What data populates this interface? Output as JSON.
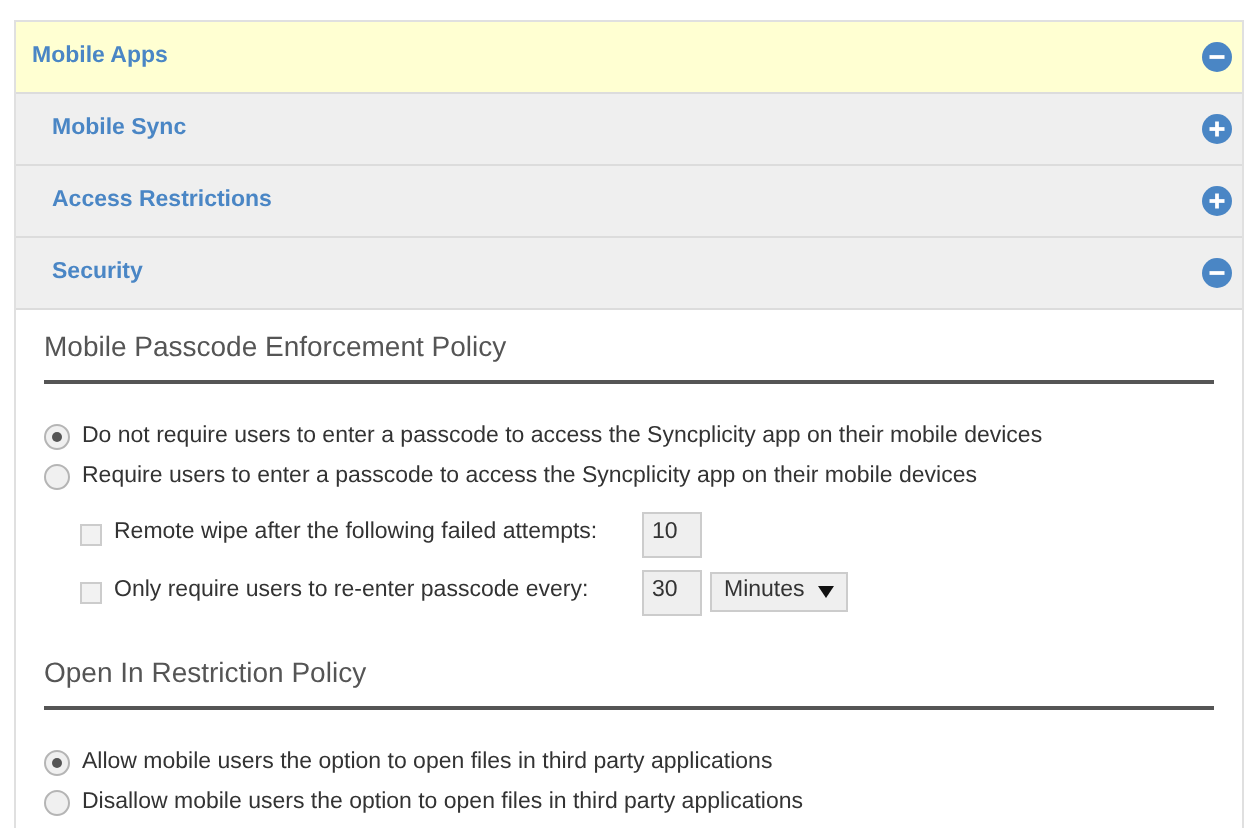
{
  "accordion": {
    "title": "Mobile Apps",
    "expanded": true,
    "sections": [
      {
        "title": "Mobile Sync",
        "expanded": false
      },
      {
        "title": "Access Restrictions",
        "expanded": false
      },
      {
        "title": "Security",
        "expanded": true
      }
    ]
  },
  "security": {
    "policies": [
      {
        "title": "Mobile Passcode Enforcement Policy",
        "options": [
          {
            "label": "Do not require users to enter a passcode to access the Syncplicity app on their mobile devices",
            "selected": true
          },
          {
            "label": "Require users to enter a passcode to access the Syncplicity app on their mobile devices",
            "selected": false
          }
        ],
        "settings": [
          {
            "label": "Remote wipe after the following failed attempts:",
            "checked": false,
            "value": "10"
          },
          {
            "label": "Only require users to re-enter passcode every:",
            "checked": false,
            "value": "30",
            "unit": "Minutes"
          }
        ]
      },
      {
        "title": "Open In Restriction Policy",
        "options": [
          {
            "label": "Allow mobile users the option to open files in third party applications",
            "selected": true
          },
          {
            "label": "Disallow mobile users the option to open files in third party applications",
            "selected": false
          }
        ]
      }
    ]
  }
}
